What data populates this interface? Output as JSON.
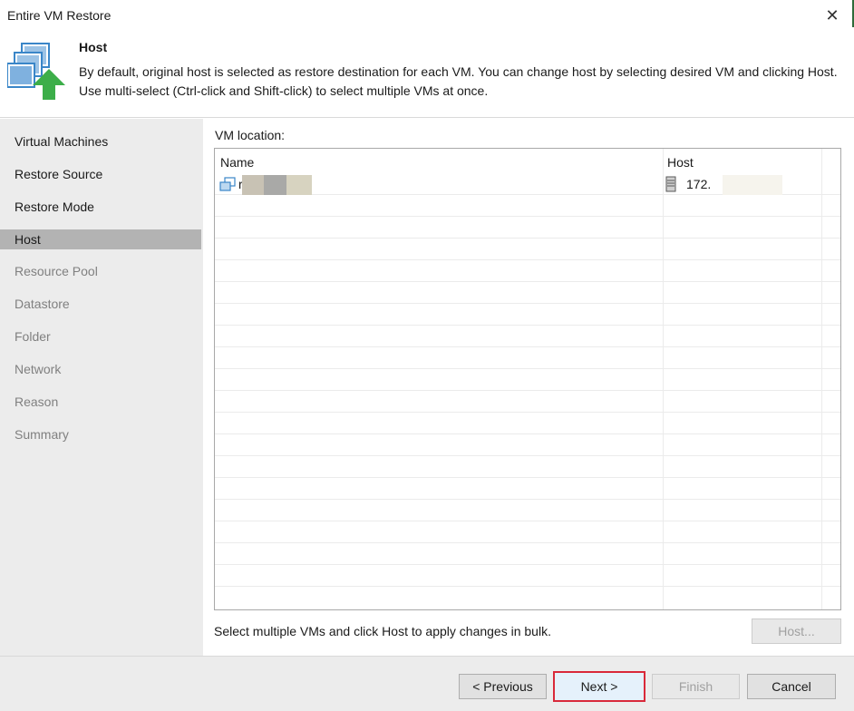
{
  "window": {
    "title": "Entire VM Restore",
    "close_glyph": "✕"
  },
  "header": {
    "title": "Host",
    "description": "By default, original host is selected as restore destination for each VM. You can change host by selecting desired VM and clicking Host. Use multi-select (Ctrl-click and Shift-click) to select multiple VMs at once.",
    "icon": "vm-restore-arrow-icon"
  },
  "sidebar": {
    "items": [
      {
        "label": "Virtual Machines",
        "state": "done"
      },
      {
        "label": "Restore Source",
        "state": "done"
      },
      {
        "label": "Restore Mode",
        "state": "done"
      },
      {
        "label": "Host",
        "state": "active"
      },
      {
        "label": "Resource Pool",
        "state": "pending"
      },
      {
        "label": "Datastore",
        "state": "pending"
      },
      {
        "label": "Folder",
        "state": "pending"
      },
      {
        "label": "Network",
        "state": "pending"
      },
      {
        "label": "Reason",
        "state": "pending"
      },
      {
        "label": "Summary",
        "state": "pending"
      }
    ]
  },
  "main": {
    "location_label": "VM location:",
    "columns": [
      "Name",
      "Host"
    ],
    "rows": [
      {
        "name": "r",
        "host": "172.",
        "name_icon": "vm-icon",
        "host_icon": "server-icon"
      }
    ],
    "hint": "Select multiple VMs and click Host to apply changes in bulk.",
    "host_button": "Host..."
  },
  "footer": {
    "previous": "< Previous",
    "next": "Next >",
    "finish": "Finish",
    "cancel": "Cancel"
  },
  "colors": {
    "accent_green": "#3cae49",
    "accent_blue": "#3a86c8",
    "selected_nav": "#b3b3b3",
    "sidebar_bg": "#ececec",
    "next_highlight": "#d9293a"
  }
}
